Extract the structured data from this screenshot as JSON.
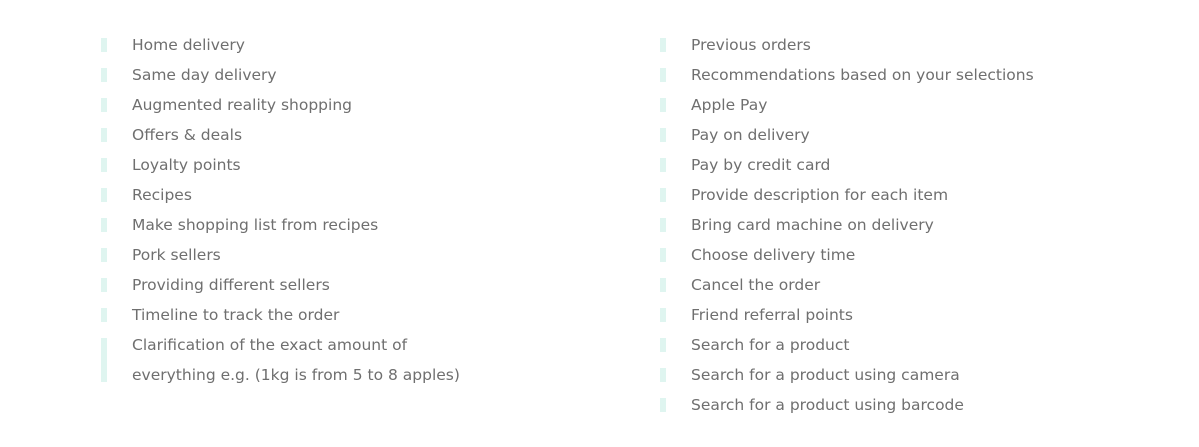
{
  "colors": {
    "marker": "#dff5f0",
    "text": "#6f6f6f",
    "background": "#ffffff"
  },
  "left_column": {
    "items": [
      "Home delivery",
      "Same day delivery",
      "Augmented reality shopping",
      "Offers & deals",
      "Loyalty points",
      "Recipes",
      "Make shopping list from recipes",
      "Pork sellers",
      "Providing different sellers",
      "Timeline to track the order",
      "Clarification of the exact amount of everything e.g. (1kg is from 5 to 8 apples)"
    ]
  },
  "right_column": {
    "items": [
      "Previous orders",
      "Recommendations based on your selections",
      "Apple Pay",
      "Pay on delivery",
      "Pay by credit card",
      "Provide description for each item",
      "Bring card machine on delivery",
      "Choose delivery time",
      "Cancel the order",
      "Friend referral points",
      "Search for a product",
      "Search for a product using camera",
      "Search for a product using barcode"
    ]
  }
}
